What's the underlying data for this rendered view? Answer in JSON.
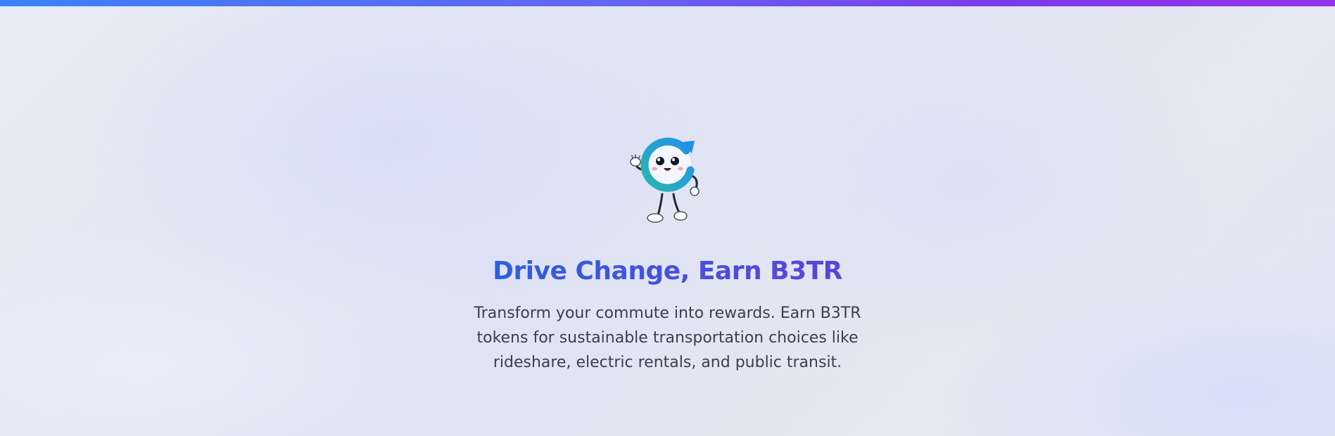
{
  "colors": {
    "top_bar_start": "#3b82f6",
    "top_bar_end": "#9333ea",
    "title_gradient_start": "#2f5fe0",
    "title_gradient_end": "#5b45d8",
    "subtitle": "#374151",
    "mascot_ring_start": "#2ab7b0",
    "mascot_ring_end": "#1e90e8"
  },
  "hero": {
    "mascot_icon": "refresh-arrow-mascot-icon",
    "title": "Drive Change, Earn B3TR",
    "subtitle": "Transform your commute into rewards. Earn B3TR tokens for sustainable transportation choices like rideshare, electric rentals, and public transit."
  }
}
